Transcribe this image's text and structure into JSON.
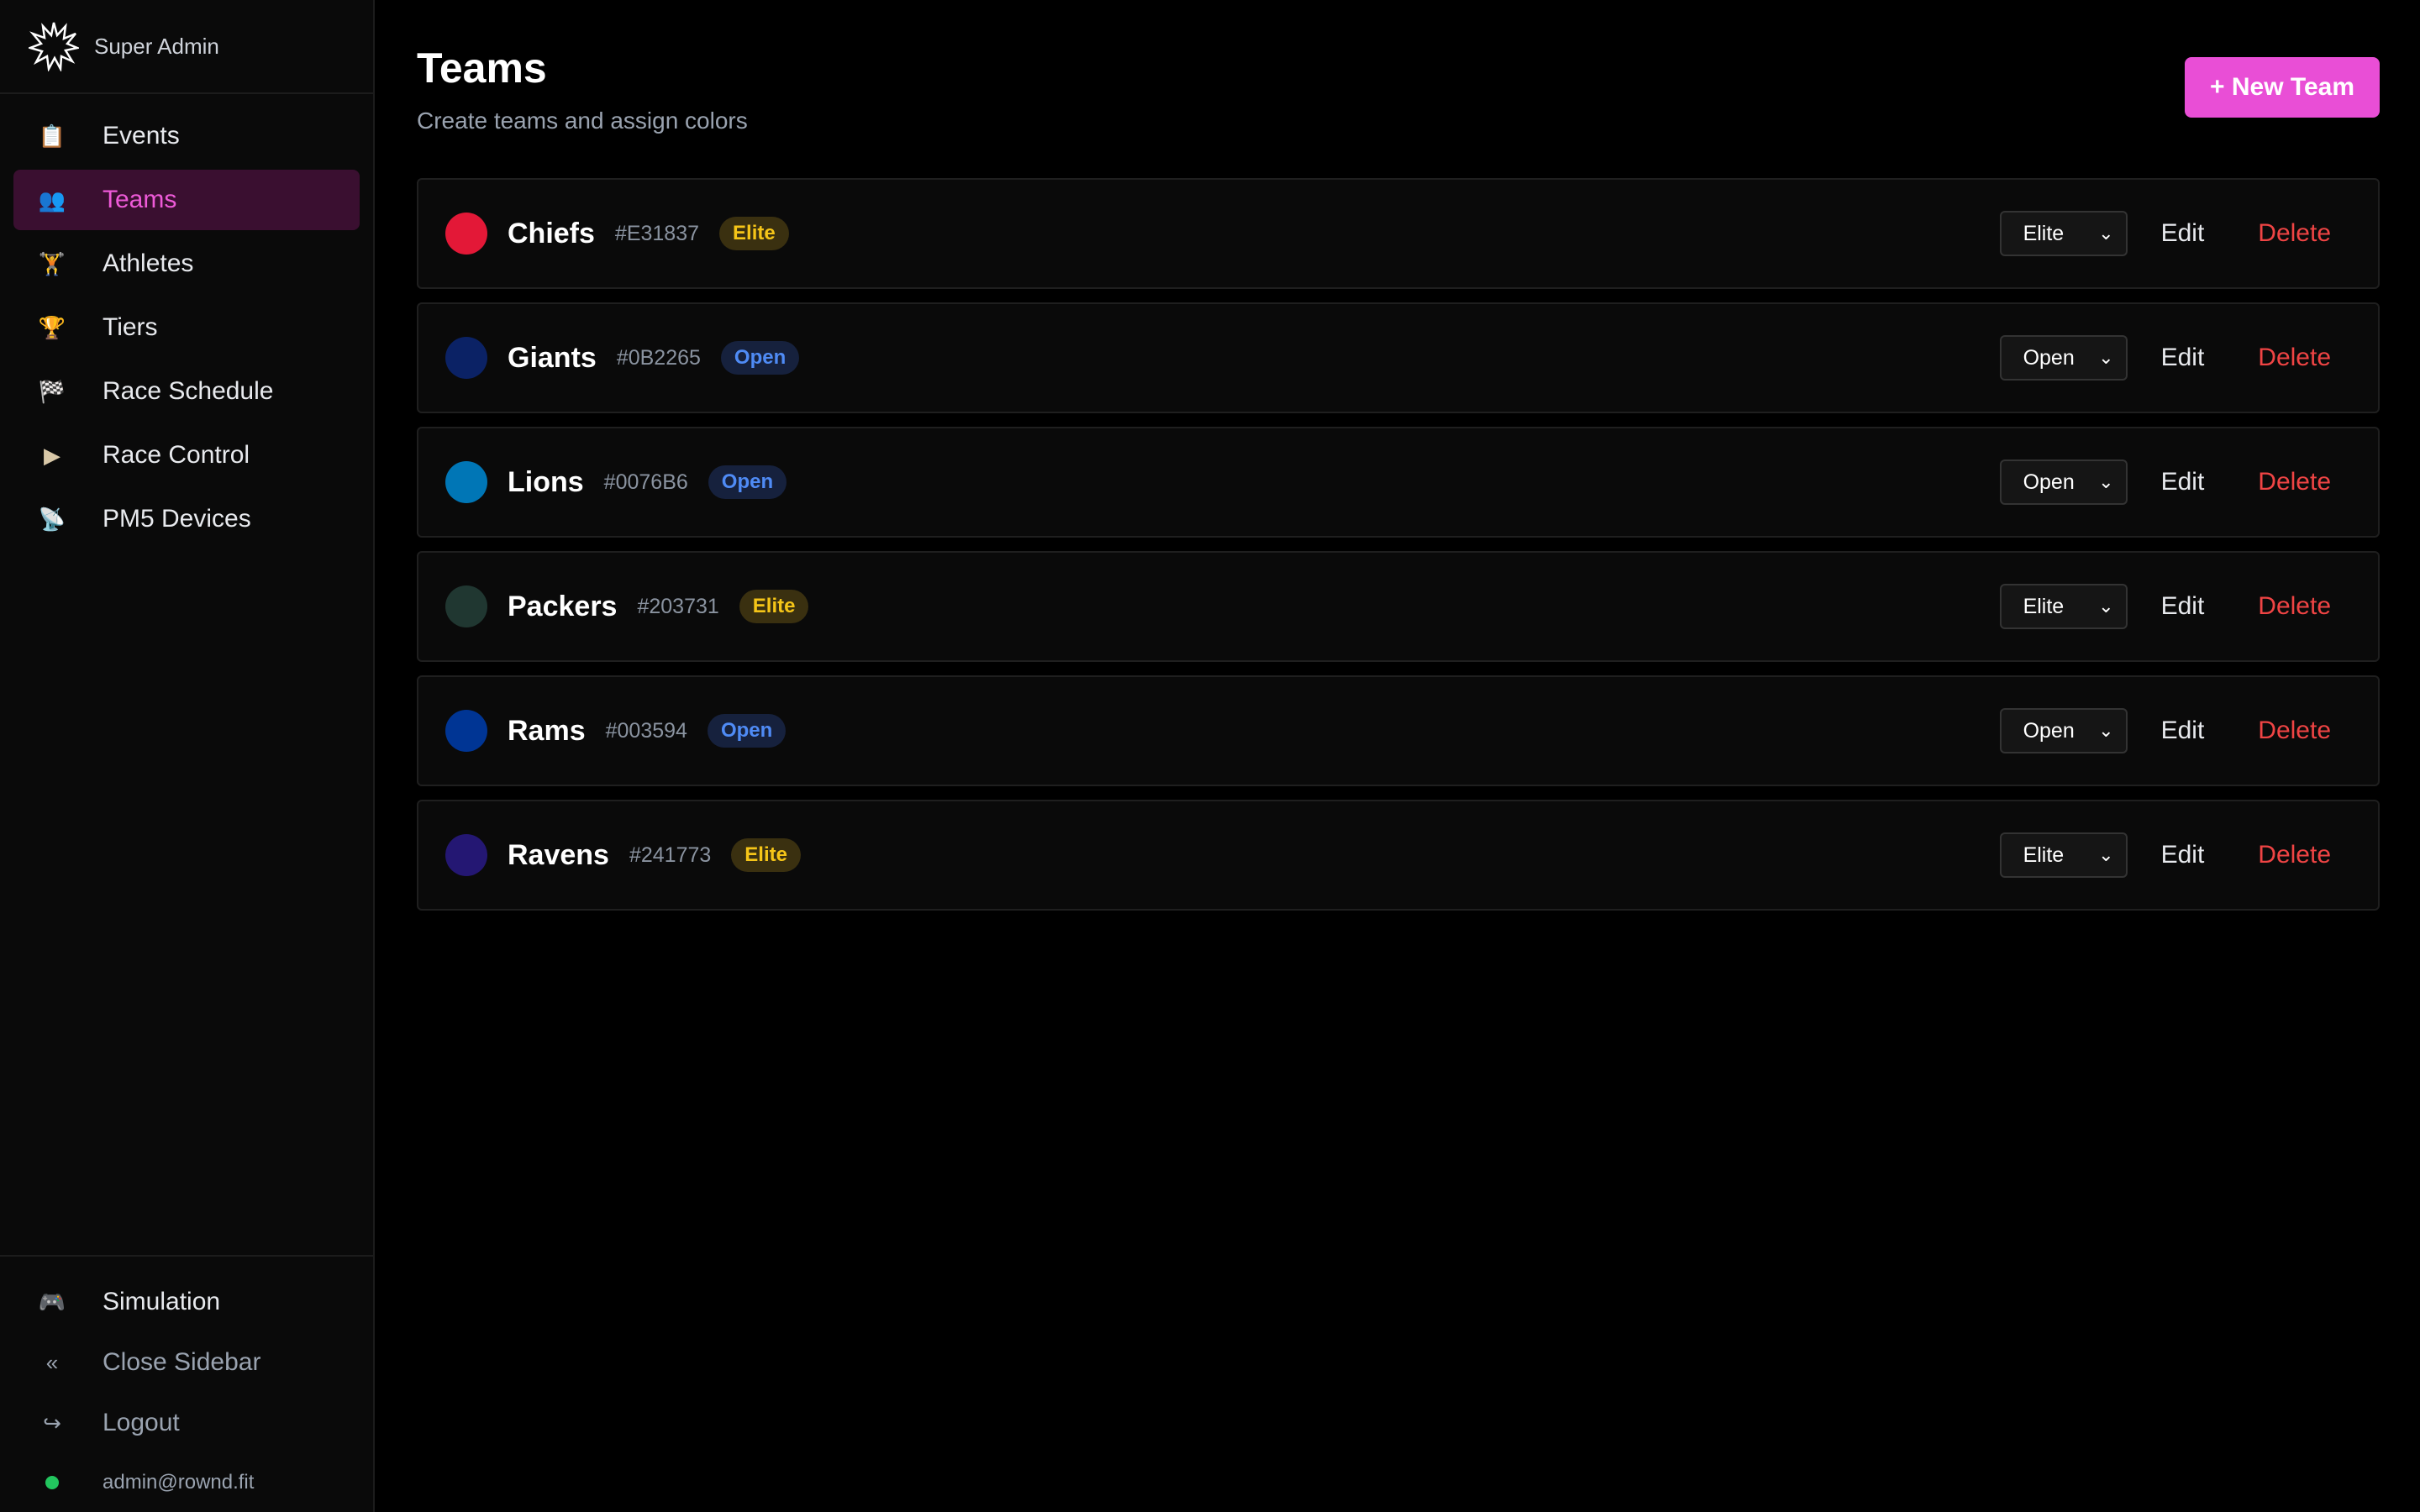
{
  "brand": {
    "label": "Super Admin"
  },
  "sidebar": {
    "items": [
      {
        "key": "events",
        "label": "Events",
        "icon": "📋"
      },
      {
        "key": "teams",
        "label": "Teams",
        "icon": "👥"
      },
      {
        "key": "athletes",
        "label": "Athletes",
        "icon": "🏋"
      },
      {
        "key": "tiers",
        "label": "Tiers",
        "icon": "🏆"
      },
      {
        "key": "race-schedule",
        "label": "Race Schedule",
        "icon": "🏁"
      },
      {
        "key": "race-control",
        "label": "Race Control",
        "icon": "▶"
      },
      {
        "key": "pm5-devices",
        "label": "PM5 Devices",
        "icon": "📡"
      }
    ],
    "active": "teams",
    "bottom": {
      "simulation": {
        "label": "Simulation",
        "icon": "🎮"
      },
      "close_sidebar": {
        "label": "Close Sidebar",
        "icon": "«"
      },
      "logout": {
        "label": "Logout",
        "icon": "↪"
      },
      "user_email": "admin@rownd.fit"
    }
  },
  "header": {
    "title": "Teams",
    "subtitle": "Create teams and assign colors",
    "new_team_label": "+ New Team"
  },
  "teams": [
    {
      "name": "Chiefs",
      "hex": "#E31837",
      "color": "#E31837",
      "tier": "Elite",
      "select": "Elite"
    },
    {
      "name": "Giants",
      "hex": "#0B2265",
      "color": "#0B2265",
      "tier": "Open",
      "select": "Open"
    },
    {
      "name": "Lions",
      "hex": "#0076B6",
      "color": "#0076B6",
      "tier": "Open",
      "select": "Open"
    },
    {
      "name": "Packers",
      "hex": "#203731",
      "color": "#203731",
      "tier": "Elite",
      "select": "Elite"
    },
    {
      "name": "Rams",
      "hex": "#003594",
      "color": "#003594",
      "tier": "Open",
      "select": "Open"
    },
    {
      "name": "Ravens",
      "hex": "#241773",
      "color": "#241773",
      "tier": "Elite",
      "select": "Elite"
    }
  ],
  "actions": {
    "edit_label": "Edit",
    "delete_label": "Delete"
  },
  "colors": {
    "accent": "#E94ED6",
    "danger": "#EF4444",
    "elite": "#F5C518",
    "open": "#4F8BF5"
  }
}
